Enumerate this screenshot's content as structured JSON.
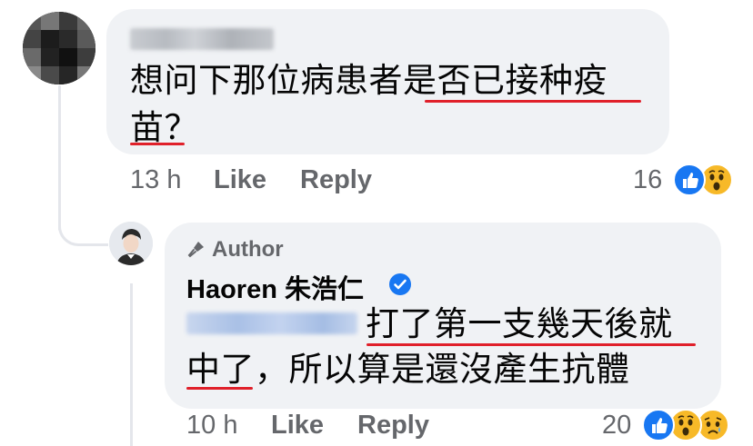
{
  "comment": {
    "author_name_redacted": true,
    "text_line1": "想问下那位病患者是否已接种疫",
    "text_line2": "苗？",
    "time": "13 h",
    "like_label": "Like",
    "reply_label": "Reply",
    "reaction_count": "16",
    "reactions": [
      "like",
      "wow"
    ]
  },
  "reply": {
    "author_badge": "Author",
    "author_name": "Haoren 朱浩仁",
    "verified": true,
    "mention_redacted": true,
    "text_line1": "打了第一支幾天後就",
    "text_line2": "中了，所以算是還沒產生抗體",
    "time": "10 h",
    "like_label": "Like",
    "reply_label": "Reply",
    "reaction_count": "20",
    "reactions": [
      "like",
      "wow",
      "sad"
    ]
  },
  "colors": {
    "bubble": "#f0f2f5",
    "meta_text": "#65676b",
    "underline": "#e0202a",
    "like_blue": "#1877f2",
    "emoji_yellow": "#f7b928",
    "thread_line": "#e4e6eb"
  }
}
